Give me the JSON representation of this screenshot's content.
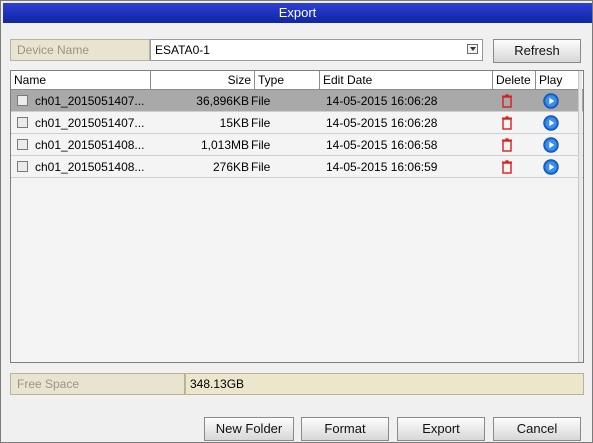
{
  "window": {
    "title": "Export"
  },
  "device": {
    "label": "Device Name",
    "value": "ESATA0-1",
    "refresh_label": "Refresh"
  },
  "table": {
    "headers": {
      "name": "Name",
      "size": "Size",
      "type": "Type",
      "edit_date": "Edit Date",
      "delete": "Delete",
      "play": "Play"
    },
    "rows": [
      {
        "name": "ch01_2015051407...",
        "size": "36,896KB",
        "type": "File",
        "edit_date": "14-05-2015 16:06:28",
        "selected": true
      },
      {
        "name": "ch01_2015051407...",
        "size": "15KB",
        "type": "File",
        "edit_date": "14-05-2015 16:06:28",
        "selected": false
      },
      {
        "name": "ch01_2015051408...",
        "size": "1,013MB",
        "type": "File",
        "edit_date": "14-05-2015 16:06:58",
        "selected": false
      },
      {
        "name": "ch01_2015051408...",
        "size": "276KB",
        "type": "File",
        "edit_date": "14-05-2015 16:06:59",
        "selected": false
      }
    ]
  },
  "free_space": {
    "label": "Free Space",
    "value": "348.13GB"
  },
  "buttons": {
    "new_folder": "New Folder",
    "format": "Format",
    "export": "Export",
    "cancel": "Cancel"
  },
  "icons": {
    "delete": "trash-icon",
    "play": "play-icon",
    "dropdown": "chevron-down-icon",
    "checkbox": "checkbox-icon"
  },
  "colors": {
    "title_bar": "#1a2fb8",
    "delete_icon": "#d62020",
    "play_icon": "#1f6fd6",
    "selected_row": "#a9a9a9"
  }
}
